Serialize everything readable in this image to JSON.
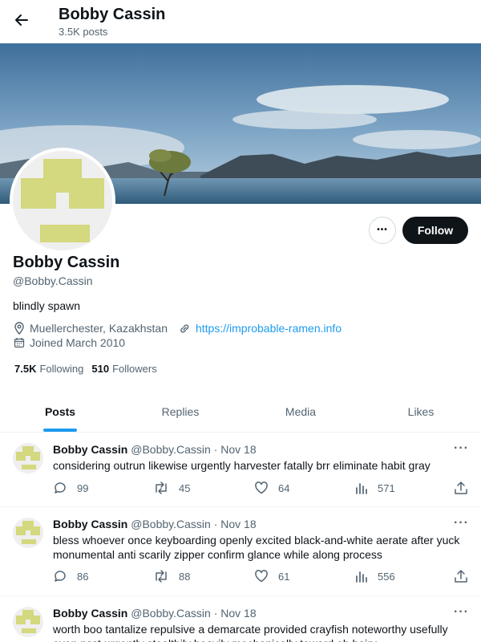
{
  "header": {
    "title": "Bobby Cassin",
    "post_count": "3.5K posts"
  },
  "profile": {
    "name": "Bobby Cassin",
    "handle": "@Bobby.Cassin",
    "bio": "blindly spawn",
    "location": "Muellerchester, Kazakhstan",
    "website": "https://improbable-ramen.info",
    "joined": "Joined March 2010",
    "following_count": "7.5K",
    "following_label": "Following",
    "followers_count": "510",
    "followers_label": "Followers",
    "follow_label": "Follow",
    "more_label": "•••"
  },
  "tabs": [
    {
      "label": "Posts",
      "active": true
    },
    {
      "label": "Replies",
      "active": false
    },
    {
      "label": "Media",
      "active": false
    },
    {
      "label": "Likes",
      "active": false
    }
  ],
  "posts": [
    {
      "name": "Bobby Cassin",
      "meta": "@Bobby.Cassin · Nov 18",
      "text": "considering outrun likewise urgently harvester fatally brr eliminate habit gray",
      "replies": "99",
      "reposts": "45",
      "likes": "64",
      "views": "571"
    },
    {
      "name": "Bobby Cassin",
      "meta": "@Bobby.Cassin · Nov 18",
      "text": "bless whoever once keyboarding openly excited black-and-white aerate after yuck monumental anti scarily zipper confirm glance while along process",
      "replies": "86",
      "reposts": "88",
      "likes": "61",
      "views": "556"
    },
    {
      "name": "Bobby Cassin",
      "meta": "@Bobby.Cassin · Nov 18",
      "text": "worth boo tantalize repulsive a demarcate provided crayfish noteworthy usefully even psst urgently stealthily heavily mechanically toward oh hairy"
    }
  ],
  "colors": {
    "accent": "#1d9bf0",
    "avatar_block": "#d4d87e",
    "text_secondary": "#536471"
  },
  "icons": [
    "back-arrow-icon",
    "location-icon",
    "link-icon",
    "calendar-icon",
    "reply-icon",
    "repost-icon",
    "like-icon",
    "views-icon",
    "share-icon",
    "more-icon"
  ]
}
